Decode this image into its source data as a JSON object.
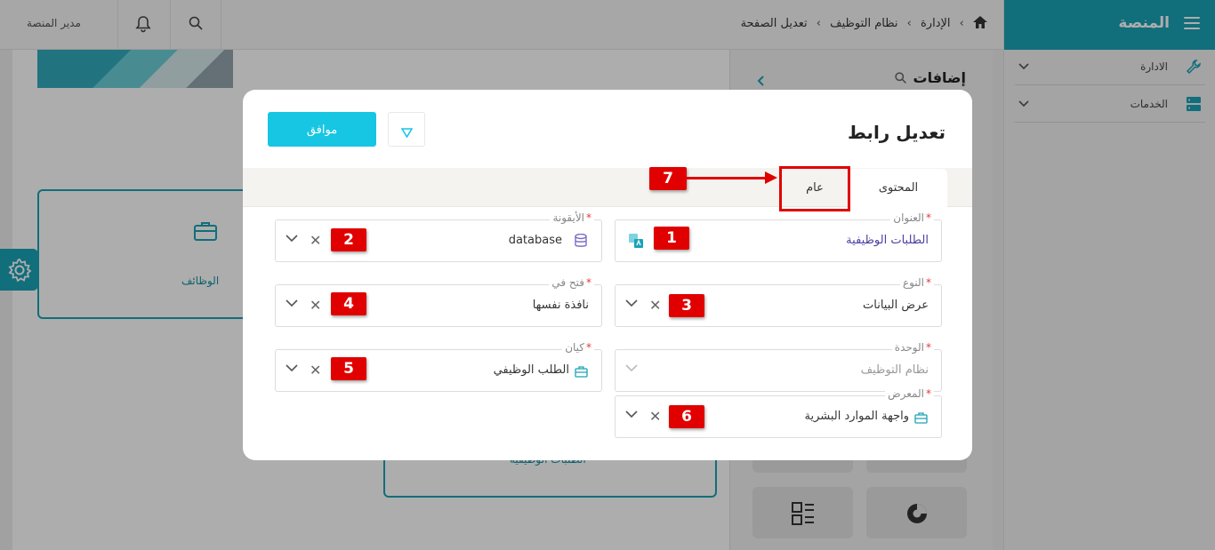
{
  "sidebar": {
    "title": "المنصة",
    "items": [
      {
        "label": "الادارة",
        "icon": "wrench-icon"
      },
      {
        "label": "الخدمات",
        "icon": "server-icon"
      }
    ]
  },
  "topbar": {
    "breadcrumbs": [
      "الإدارة",
      "نظام التوظيف",
      "تعديل الصفحة"
    ],
    "user": "مدير المنصة"
  },
  "canvas": {
    "card_label": "الوظائف",
    "bottom_card_label": "الطلبات الوظيفية"
  },
  "panel": {
    "title": "إضافات"
  },
  "modal": {
    "title": "تعديل رابط",
    "ok_label": "موافق",
    "tabs": [
      {
        "label": "المحتوى",
        "active": true
      },
      {
        "label": "عام",
        "active": false
      }
    ],
    "fields": {
      "title": {
        "label": "العنوان",
        "value": "الطلبات الوظيفية"
      },
      "icon": {
        "label": "الأيقونة",
        "value": "database"
      },
      "type": {
        "label": "النوع",
        "value": "عرض البيانات"
      },
      "open_in": {
        "label": "فتح في",
        "value": "نافذة نفسها"
      },
      "module": {
        "label": "الوحدة",
        "value": "نظام التوظيف"
      },
      "entity": {
        "label": "كيان",
        "value": "الطلب الوظيفي"
      },
      "gallery": {
        "label": "المعرض",
        "value": "واجهة الموارد البشرية"
      }
    }
  },
  "annotations": [
    "1",
    "2",
    "3",
    "4",
    "5",
    "6",
    "7"
  ],
  "colors": {
    "accent": "#1aa3b5",
    "button": "#17c6e3",
    "callout": "#e00000"
  }
}
